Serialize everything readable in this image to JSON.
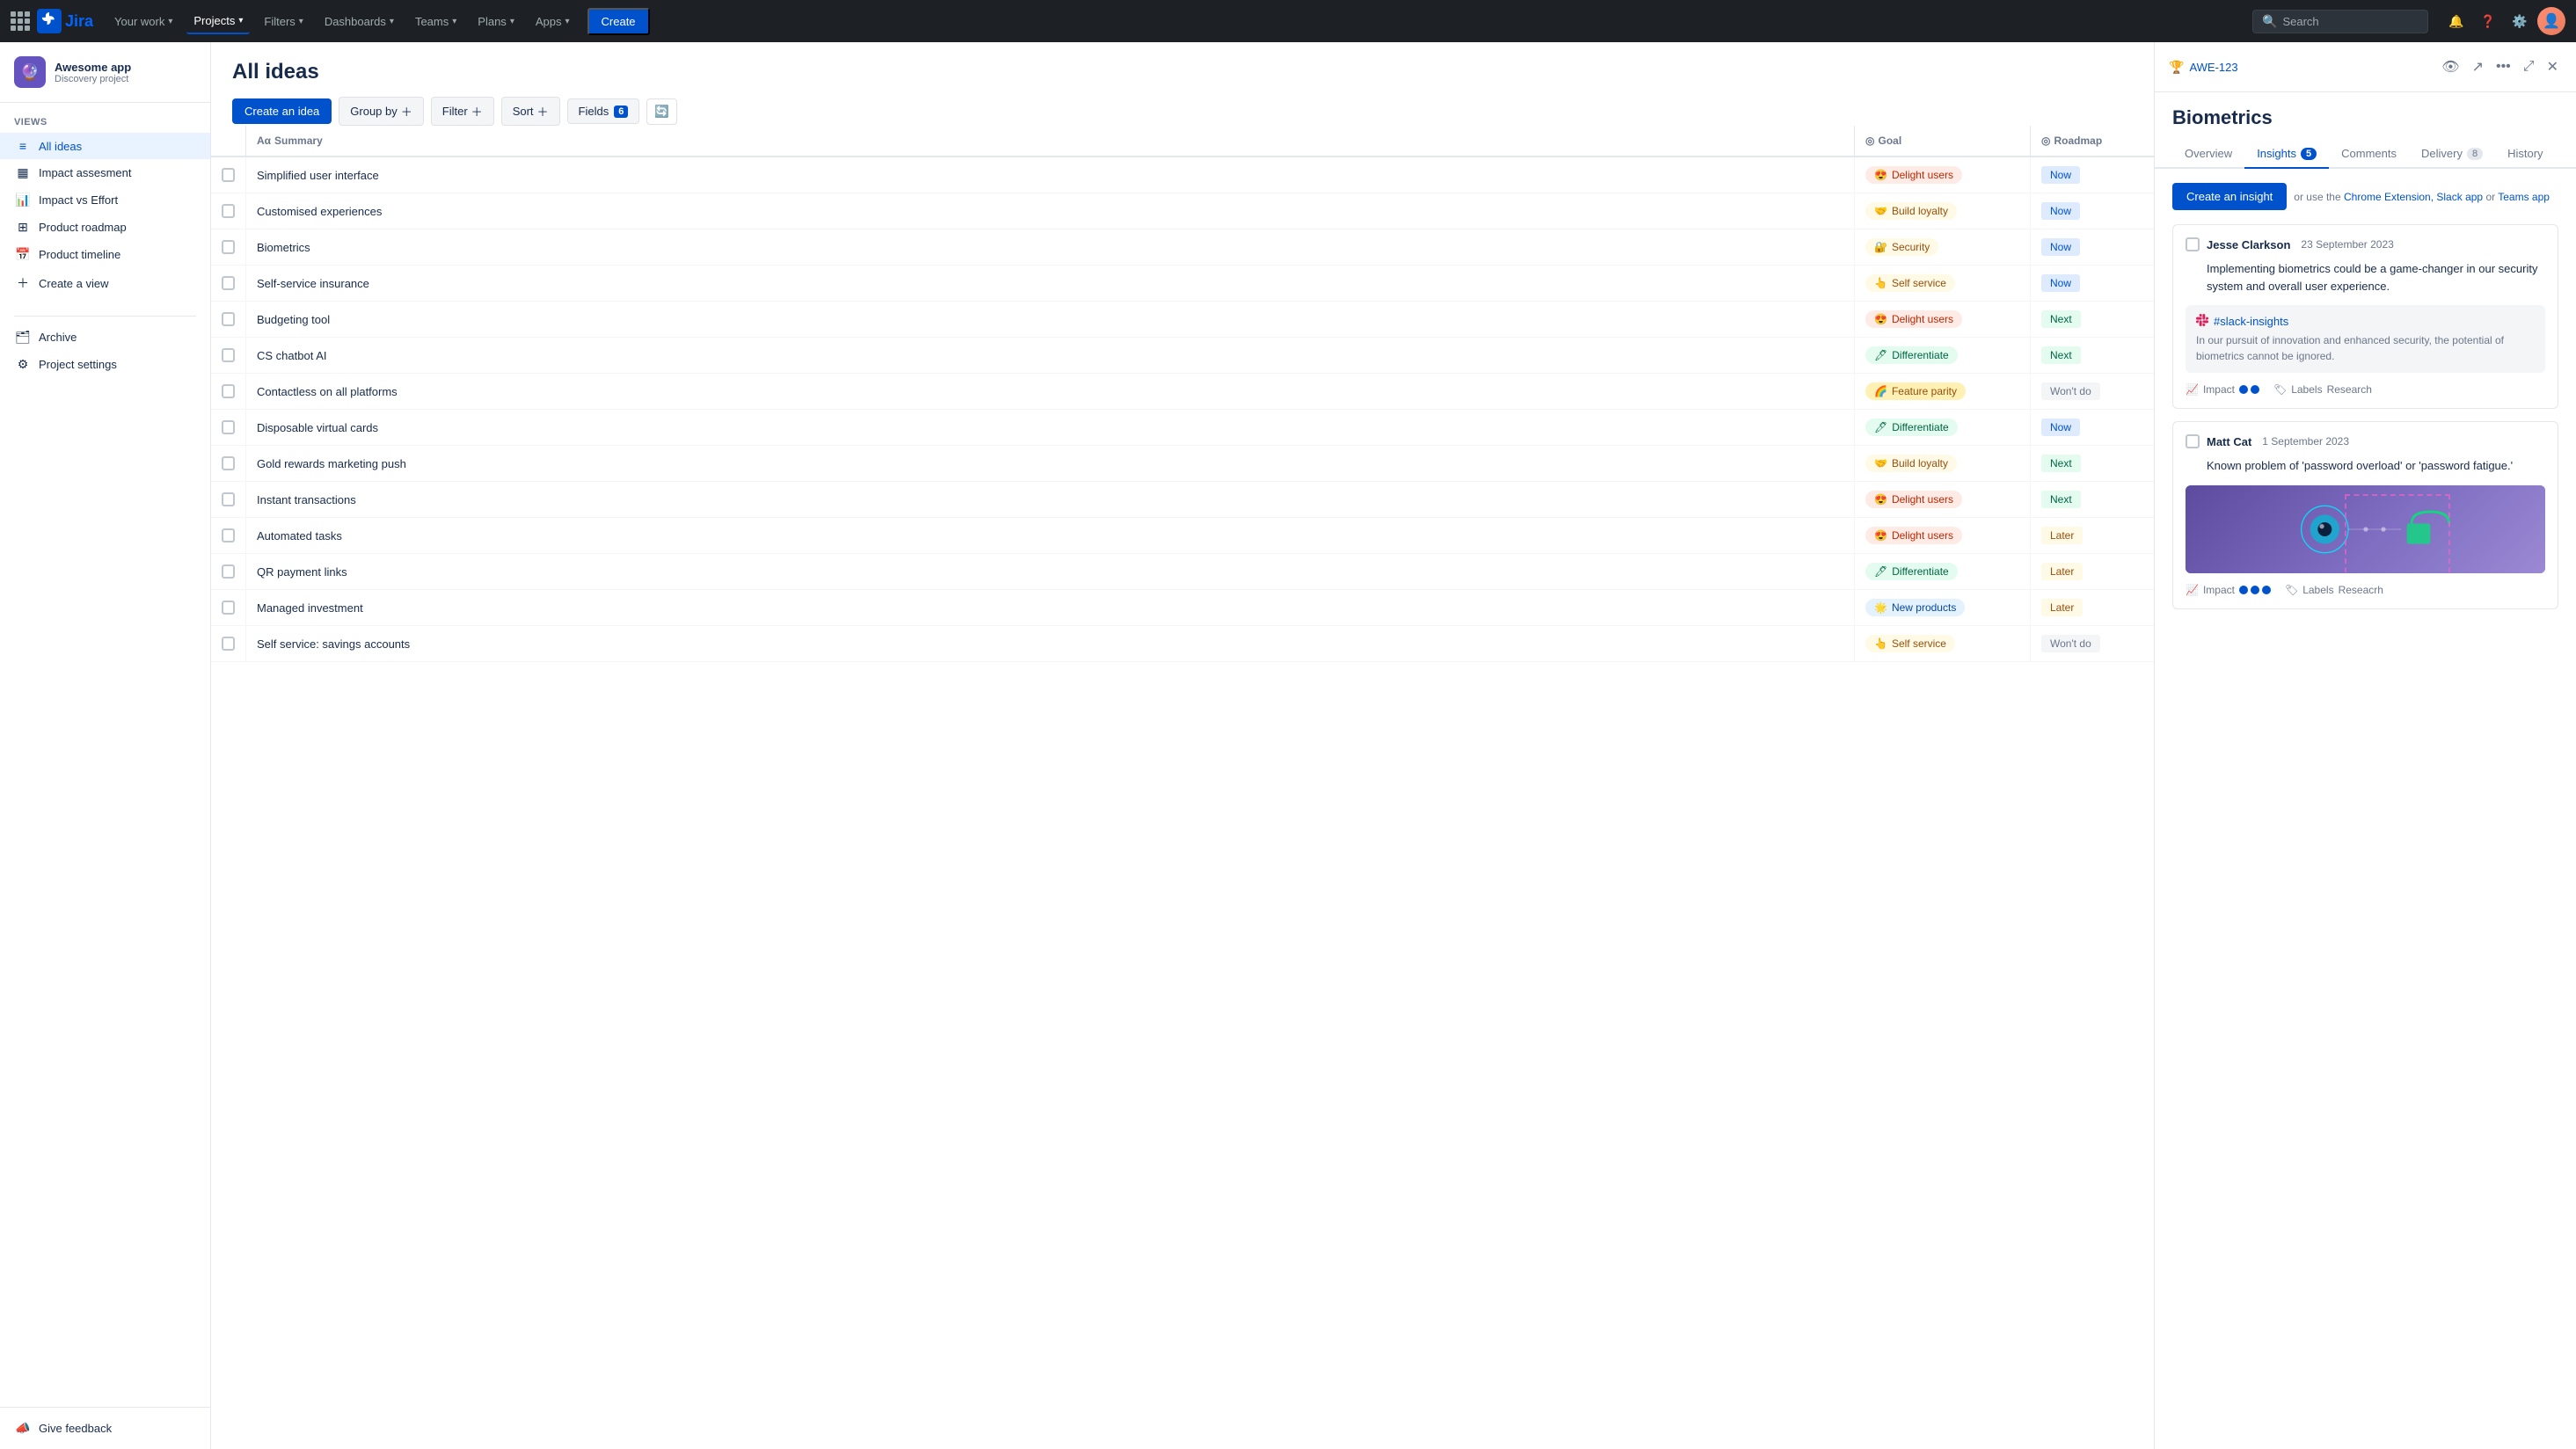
{
  "app": {
    "name": "Jira"
  },
  "topnav": {
    "items": [
      {
        "id": "your-work",
        "label": "Your work",
        "hasChevron": true
      },
      {
        "id": "projects",
        "label": "Projects",
        "hasChevron": true
      },
      {
        "id": "filters",
        "label": "Filters",
        "hasChevron": true
      },
      {
        "id": "dashboards",
        "label": "Dashboards",
        "hasChevron": true
      },
      {
        "id": "teams",
        "label": "Teams",
        "hasChevron": true
      },
      {
        "id": "plans",
        "label": "Plans",
        "hasChevron": true
      },
      {
        "id": "apps",
        "label": "Apps",
        "hasChevron": true
      }
    ],
    "create_label": "Create",
    "search_placeholder": "Search"
  },
  "sidebar": {
    "project_name": "Awesome app",
    "project_type": "Discovery project",
    "views_label": "VIEWS",
    "nav_items": [
      {
        "id": "all-ideas",
        "label": "All ideas",
        "icon": "list",
        "active": true
      },
      {
        "id": "impact-assessment",
        "label": "Impact assesment",
        "icon": "bars"
      },
      {
        "id": "impact-effort",
        "label": "Impact vs Effort",
        "icon": "chart"
      },
      {
        "id": "product-roadmap",
        "label": "Product roadmap",
        "icon": "grid"
      },
      {
        "id": "product-timeline",
        "label": "Product timeline",
        "icon": "timeline"
      }
    ],
    "create_view_label": "Create a view",
    "archive_label": "Archive",
    "settings_label": "Project settings",
    "feedback_label": "Give feedback"
  },
  "main": {
    "title": "All ideas",
    "toolbar": {
      "create_idea": "Create an idea",
      "group_by": "Group by",
      "filter": "Filter",
      "sort": "Sort",
      "fields": "Fields",
      "fields_count": "6"
    },
    "table": {
      "headers": [
        "",
        "Summary",
        "Goal",
        "Roadmap"
      ],
      "rows": [
        {
          "id": 1,
          "summary": "Simplified user interface",
          "goal": "Delight users",
          "goal_type": "delight",
          "roadmap": "Now",
          "roadmap_type": "now"
        },
        {
          "id": 2,
          "summary": "Customised experiences",
          "goal": "Build loyalty",
          "goal_type": "loyalty",
          "roadmap": "Now",
          "roadmap_type": "now"
        },
        {
          "id": 3,
          "summary": "Biometrics",
          "goal": "Security",
          "goal_type": "security",
          "roadmap": "Now",
          "roadmap_type": "now"
        },
        {
          "id": 4,
          "summary": "Self-service insurance",
          "goal": "Self service",
          "goal_type": "selfservice",
          "roadmap": "Now",
          "roadmap_type": "now"
        },
        {
          "id": 5,
          "summary": "Budgeting tool",
          "goal": "Delight users",
          "goal_type": "delight",
          "roadmap": "Next",
          "roadmap_type": "next"
        },
        {
          "id": 6,
          "summary": "CS chatbot AI",
          "goal": "Differentiate",
          "goal_type": "differentiate",
          "roadmap": "Next",
          "roadmap_type": "next"
        },
        {
          "id": 7,
          "summary": "Contactless on all platforms",
          "goal": "Feature parity",
          "goal_type": "feature",
          "roadmap": "Won't do",
          "roadmap_type": "wontdo"
        },
        {
          "id": 8,
          "summary": "Disposable virtual cards",
          "goal": "Differentiate",
          "goal_type": "differentiate",
          "roadmap": "Now",
          "roadmap_type": "now"
        },
        {
          "id": 9,
          "summary": "Gold rewards marketing push",
          "goal": "Build loyalty",
          "goal_type": "loyalty",
          "roadmap": "Next",
          "roadmap_type": "next"
        },
        {
          "id": 10,
          "summary": "Instant transactions",
          "goal": "Delight users",
          "goal_type": "delight",
          "roadmap": "Next",
          "roadmap_type": "next"
        },
        {
          "id": 11,
          "summary": "Automated tasks",
          "goal": "Delight users",
          "goal_type": "delight",
          "roadmap": "Later",
          "roadmap_type": "later"
        },
        {
          "id": 12,
          "summary": "QR payment links",
          "goal": "Differentiate",
          "goal_type": "differentiate",
          "roadmap": "Later",
          "roadmap_type": "later"
        },
        {
          "id": 13,
          "summary": "Managed investment",
          "goal": "New products",
          "goal_type": "newproducts",
          "roadmap": "Later",
          "roadmap_type": "later"
        },
        {
          "id": 14,
          "summary": "Self service: savings accounts",
          "goal": "Self service",
          "goal_type": "selfservice",
          "roadmap": "Won't do",
          "roadmap_type": "wontdo"
        }
      ]
    }
  },
  "panel": {
    "id": "AWE-123",
    "title": "Biometrics",
    "tabs": [
      {
        "id": "overview",
        "label": "Overview",
        "count": null
      },
      {
        "id": "insights",
        "label": "Insights",
        "count": 5
      },
      {
        "id": "comments",
        "label": "Comments",
        "count": null
      },
      {
        "id": "delivery",
        "label": "Delivery",
        "count": 8
      },
      {
        "id": "history",
        "label": "History",
        "count": null
      }
    ],
    "active_tab": "insights",
    "create_insight_label": "Create an insight",
    "insight_hint": "or use the",
    "insight_hint_chrome": "Chrome Extension,",
    "insight_hint_slack": "Slack app",
    "insight_hint_or": "or",
    "insight_hint_teams": "Teams app",
    "insights": [
      {
        "id": 1,
        "author": "Jesse Clarkson",
        "date": "23 September 2023",
        "text": "Implementing biometrics could be a game-changer in our security system and overall user experience.",
        "source": {
          "icon": "slack",
          "name": "#slack-insights",
          "text": "In our pursuit of innovation and enhanced security, the potential of biometrics cannot be ignored."
        },
        "impact_dots": 2,
        "labels": "Research"
      },
      {
        "id": 2,
        "author": "Matt Cat",
        "date": "1 September 2023",
        "text": "Known problem of 'password overload' or 'password fatigue.'",
        "has_image": true,
        "impact_dots": 3,
        "labels": "Reseacrh"
      }
    ]
  }
}
